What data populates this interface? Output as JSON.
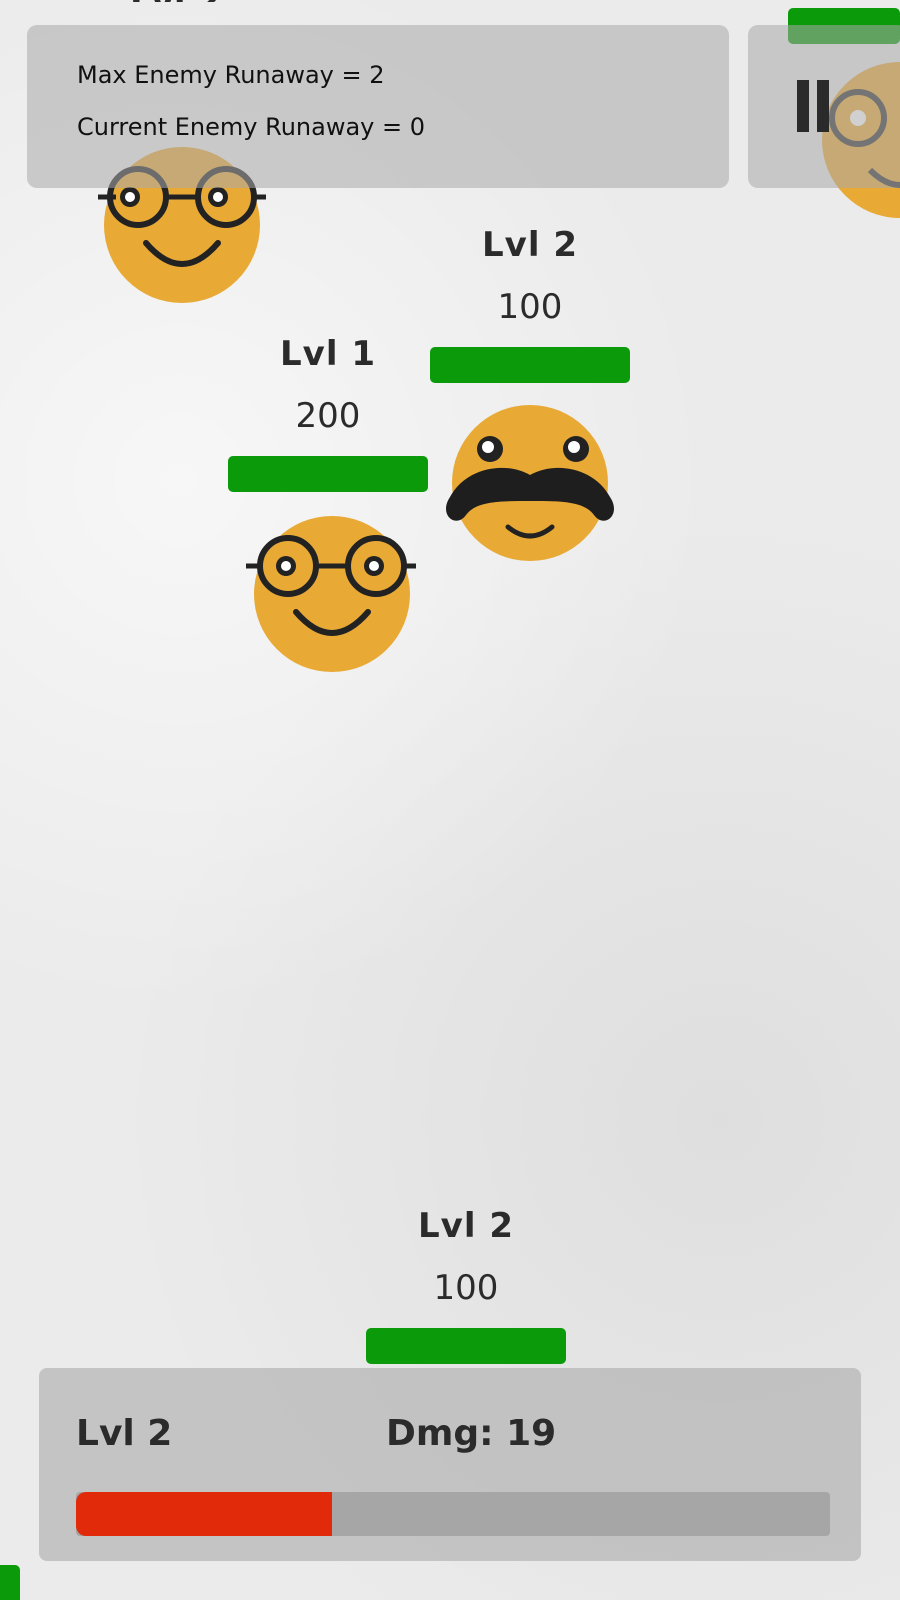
{
  "hud": {
    "max_runaway": "Max Enemy Runaway = 2",
    "current_runaway": "Current Enemy Runaway = 0"
  },
  "pause": {
    "icon": "pause-icon"
  },
  "enemies": [
    {
      "level": "Lvl 2",
      "hp": "100",
      "face": "mustache-face"
    },
    {
      "level": "Lvl 1",
      "hp": "200",
      "face": "glasses-face"
    }
  ],
  "tower": {
    "level": "Lvl 2",
    "hp": "100"
  },
  "player": {
    "level": "Lvl 2",
    "damage": "Dmg: 19",
    "xp_fraction": 0.34
  },
  "colors": {
    "face": "#e8a935",
    "health": "#0a9a0a",
    "xp": "#e02a0a"
  }
}
